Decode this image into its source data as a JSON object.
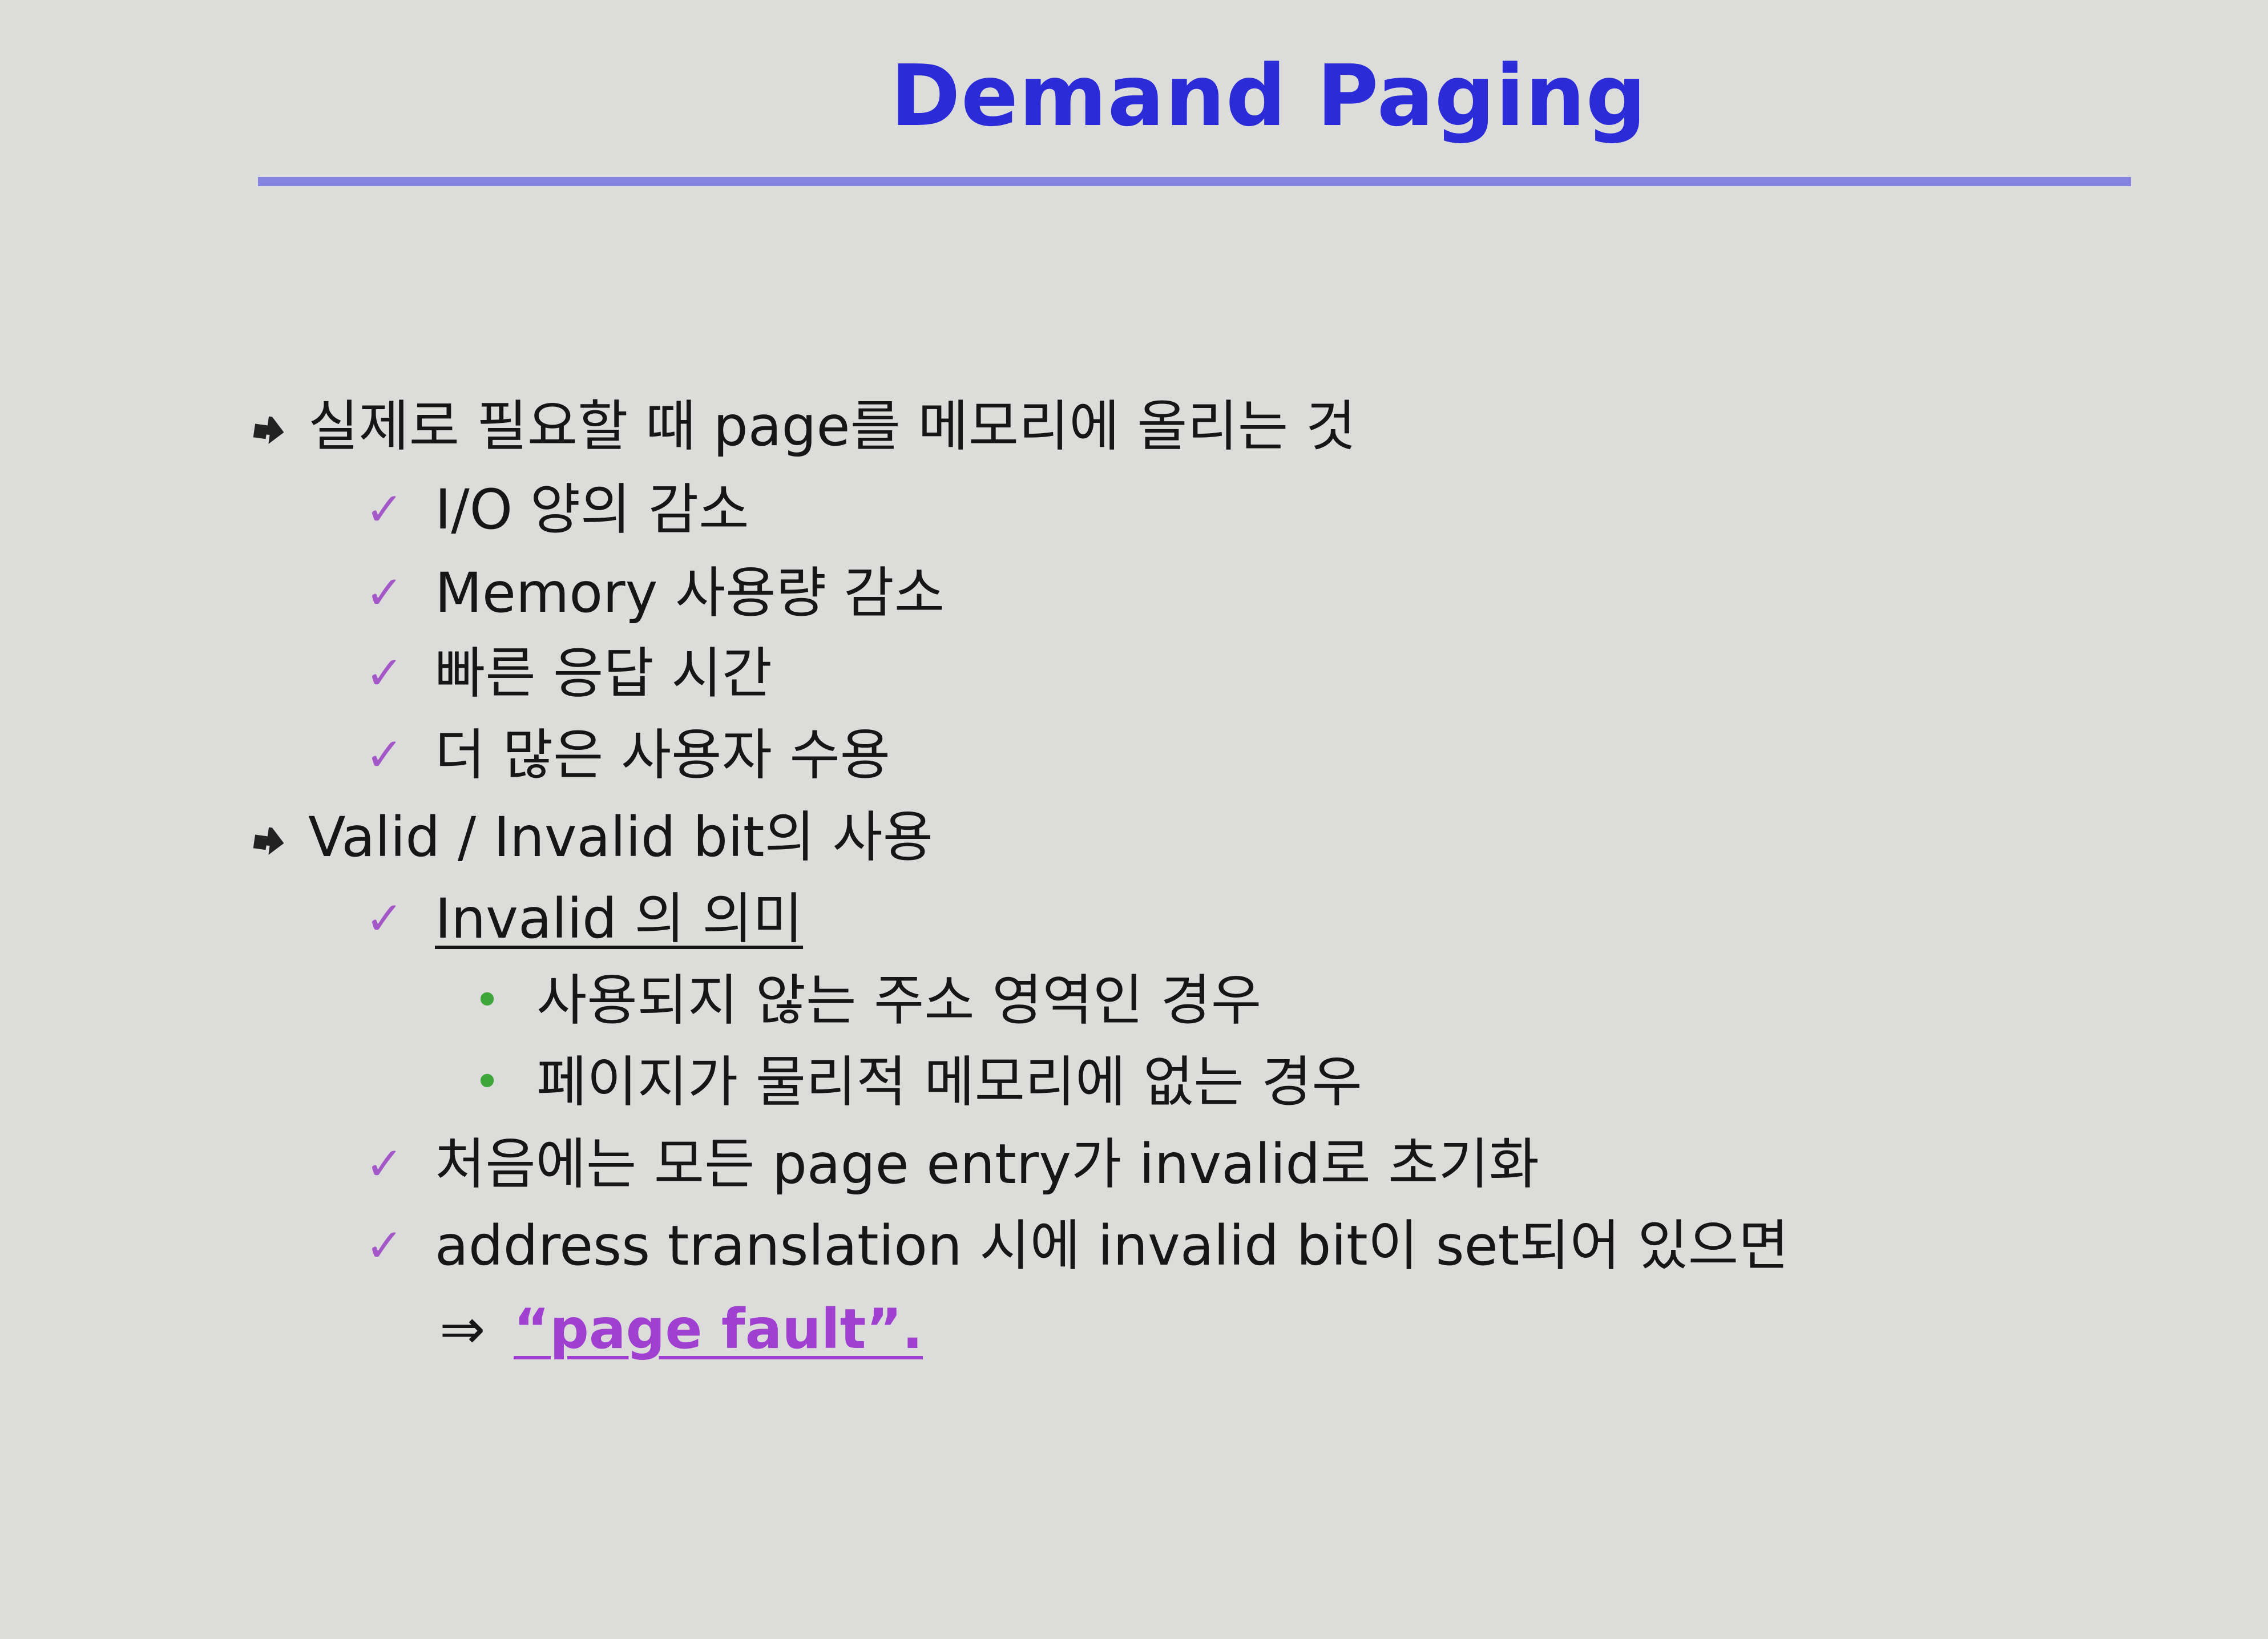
{
  "slide": {
    "title": "Demand Paging",
    "colors": {
      "title": "#2b2bd8",
      "rule": "#8484e0",
      "check": "#a457c6",
      "dot": "#3fa63b",
      "highlight": "#a040d0",
      "background": "#dcdcdb"
    },
    "items": [
      {
        "level": 1,
        "marker": "arrow-bullet-icon",
        "text": "실제로 필요할 때 page를 메모리에 올리는 것"
      },
      {
        "level": 2,
        "marker": "check-icon",
        "text": "I/O 양의 감소"
      },
      {
        "level": 2,
        "marker": "check-icon",
        "text": "Memory 사용량 감소"
      },
      {
        "level": 2,
        "marker": "check-icon",
        "text": "빠른 응답 시간"
      },
      {
        "level": 2,
        "marker": "check-icon",
        "text": "더 많은 사용자 수용"
      },
      {
        "level": 1,
        "marker": "arrow-bullet-icon",
        "text": "Valid / Invalid bit의 사용"
      },
      {
        "level": 2,
        "marker": "check-icon",
        "text": "Invalid 의 의미"
      },
      {
        "level": 3,
        "marker": "dot-icon",
        "text": "사용되지 않는 주소 영역인 경우"
      },
      {
        "level": 3,
        "marker": "dot-icon",
        "text": "페이지가 물리적 메모리에 없는 경우"
      },
      {
        "level": 2,
        "marker": "check-icon",
        "text": "처음에는 모든 page entry가 invalid로 초기화"
      },
      {
        "level": 2,
        "marker": "check-icon",
        "text": "address translation 시에 invalid bit이 set되어 있으면"
      }
    ],
    "conclusion": {
      "arrow": "⇒",
      "text": "“page fault”."
    }
  }
}
